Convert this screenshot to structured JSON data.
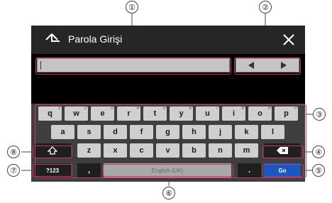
{
  "header": {
    "title": "Parola Girişi"
  },
  "keyboard": {
    "row1": [
      {
        "label": "q",
        "sup": "1"
      },
      {
        "label": "w",
        "sup": "2"
      },
      {
        "label": "e",
        "sup": "3"
      },
      {
        "label": "r",
        "sup": "4"
      },
      {
        "label": "t",
        "sup": "5"
      },
      {
        "label": "y",
        "sup": "6"
      },
      {
        "label": "u",
        "sup": "7"
      },
      {
        "label": "i",
        "sup": "8"
      },
      {
        "label": "o",
        "sup": "9"
      },
      {
        "label": "p",
        "sup": "0"
      }
    ],
    "row2": [
      "a",
      "s",
      "d",
      "f",
      "g",
      "h",
      "j",
      "k",
      "l"
    ],
    "row3": [
      "z",
      "x",
      "c",
      "v",
      "b",
      "n",
      "m"
    ],
    "comma": ",",
    "period": ".",
    "space_label": "English (UK)",
    "numbers_label": "?123",
    "go_label": "Go"
  },
  "callouts": [
    "①",
    "②",
    "③",
    "④",
    "⑤",
    "⑥",
    "⑦",
    "⑧"
  ],
  "colors": {
    "highlight": "#c83a5c",
    "go": "#1a56c4",
    "header": "#262626"
  }
}
